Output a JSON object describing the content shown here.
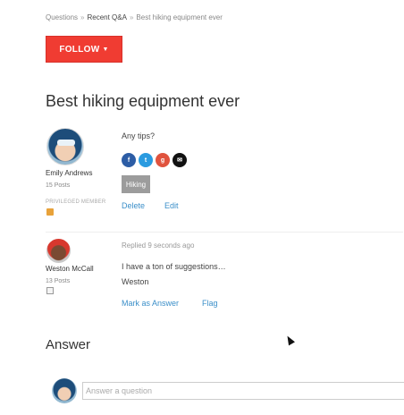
{
  "breadcrumb": {
    "items": [
      "Questions",
      "Recent Q&A",
      "Best hiking equipment ever"
    ],
    "separator": "»"
  },
  "follow_button": {
    "label": "FOLLOW",
    "color": "#f03c32"
  },
  "question": {
    "title": "Best hiking equipment ever",
    "body": "Any tips?",
    "author": {
      "name": "Emily Andrews",
      "posts": "15 Posts",
      "rank": "PRIVILEGED MEMBER"
    },
    "share_icons": [
      "facebook-icon",
      "twitter-icon",
      "google-plus-icon",
      "email-icon"
    ],
    "tag": "Hiking",
    "actions": {
      "delete": "Delete",
      "edit": "Edit"
    }
  },
  "reply": {
    "author": {
      "name": "Weston McCall",
      "posts": "13 Posts"
    },
    "meta": "Replied 9 seconds ago",
    "body_line1": "I have a ton of suggestions…",
    "body_line2": "Weston",
    "actions": {
      "mark_answer": "Mark as Answer",
      "flag": "Flag"
    }
  },
  "answer_section": {
    "heading": "Answer",
    "placeholder": "Answer a question"
  },
  "colors": {
    "link": "#3b8fc9",
    "accent": "#f03c32",
    "tag_bg": "#9c9c9c"
  }
}
